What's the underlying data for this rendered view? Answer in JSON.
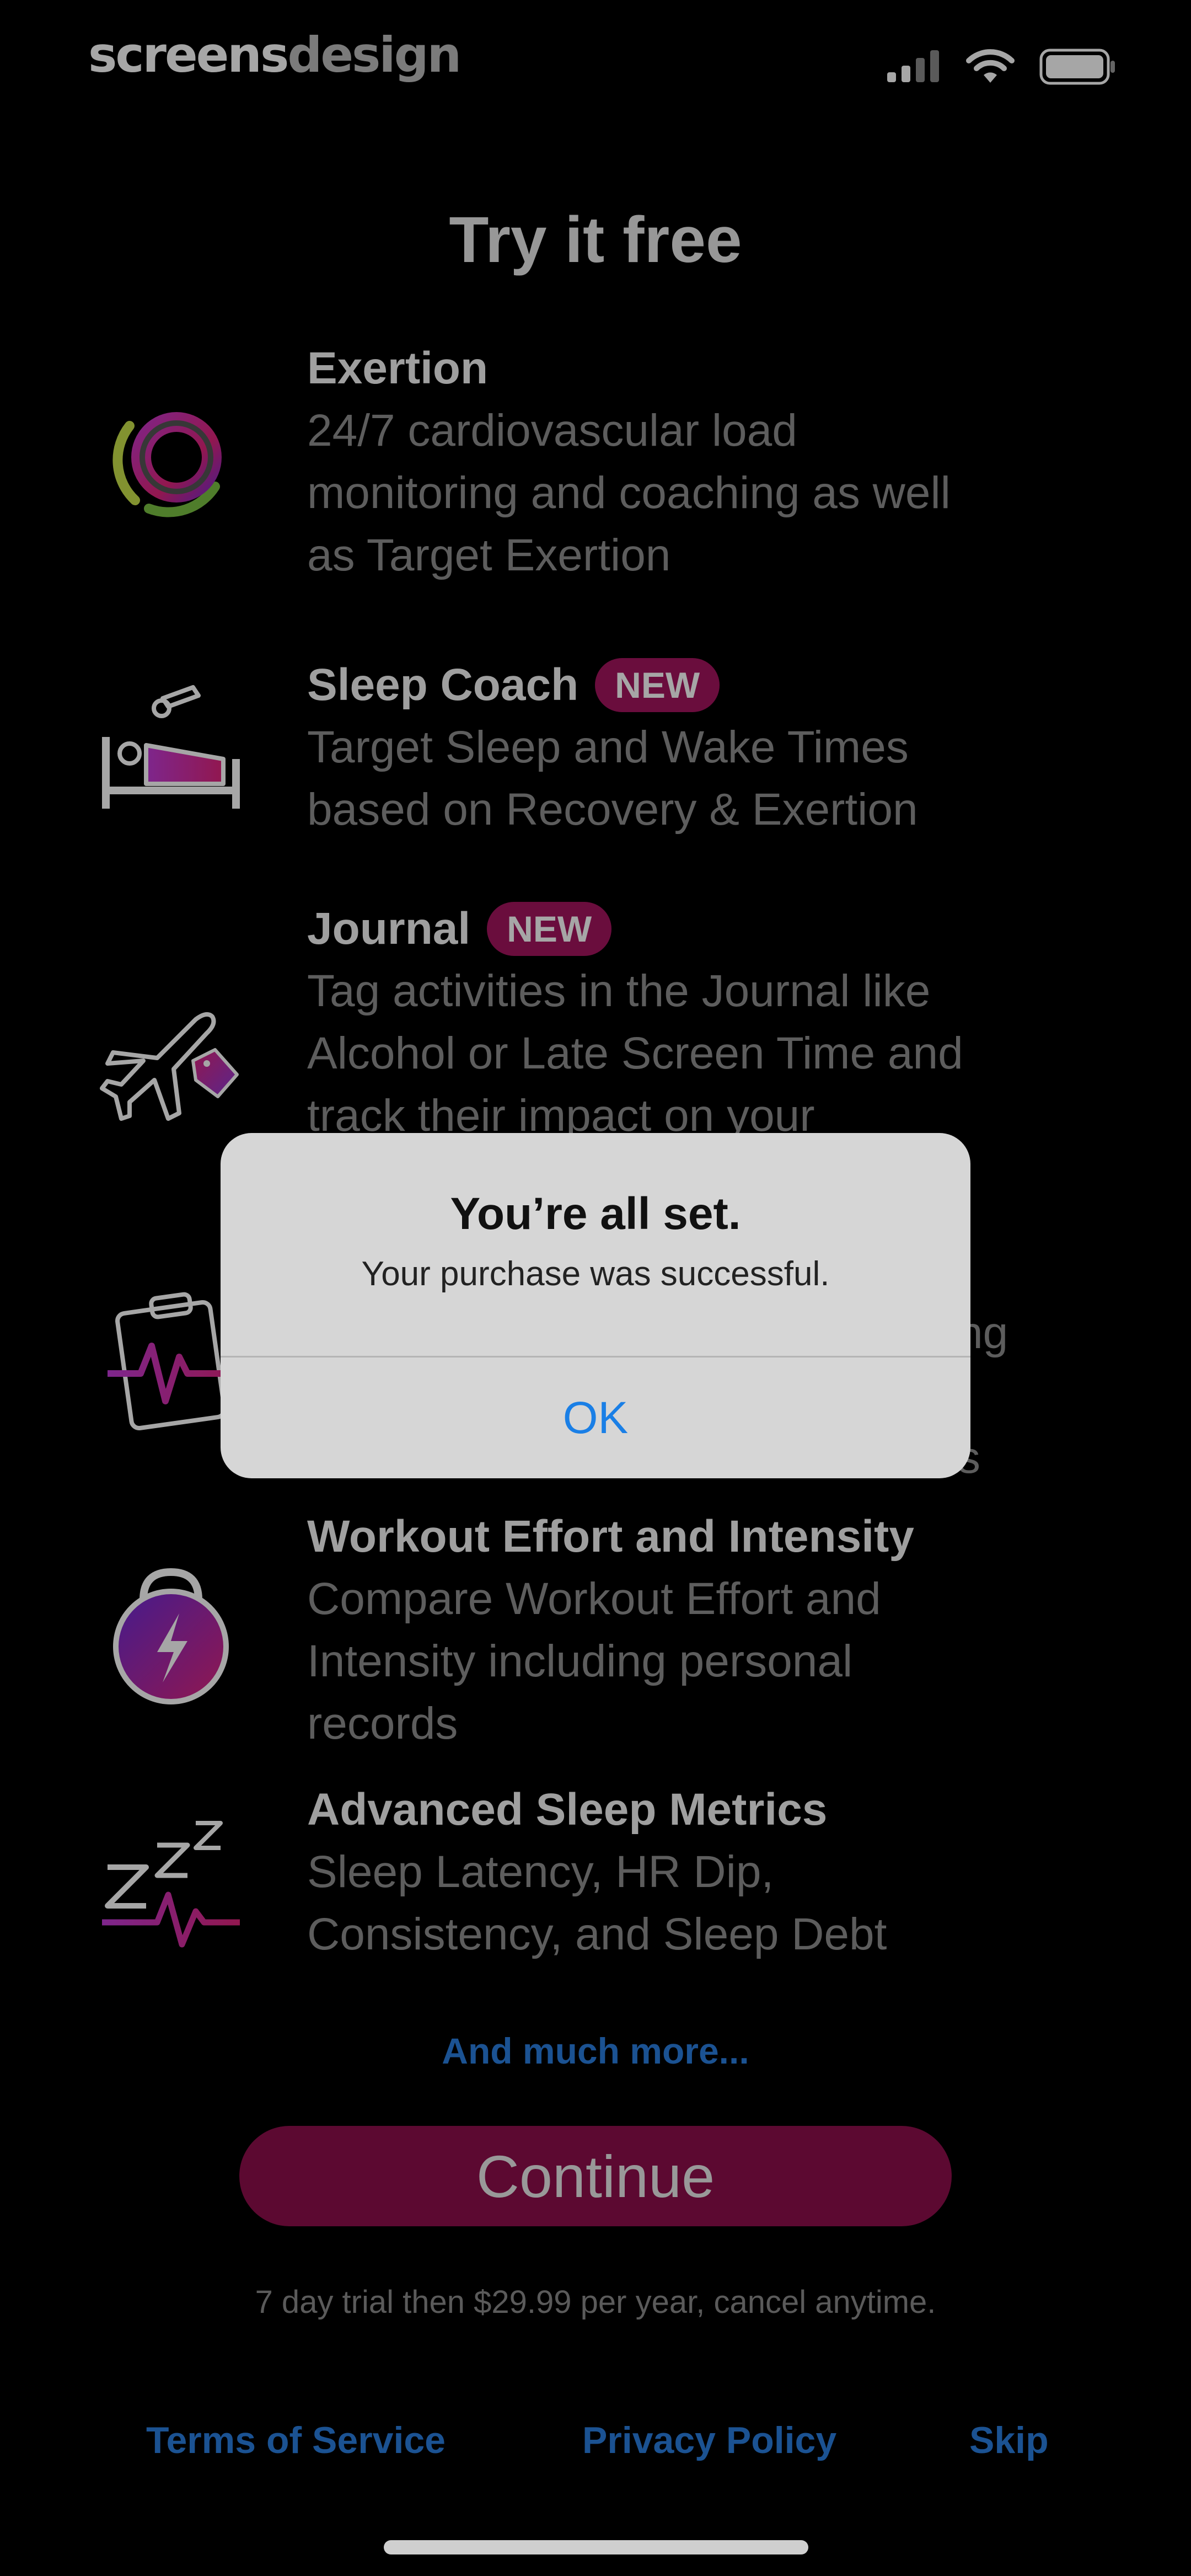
{
  "status_bar": {
    "brand_part1": "screens",
    "brand_part2": "design",
    "icons": [
      "signal-icon",
      "wifi-icon",
      "battery-icon"
    ]
  },
  "title": "Try it free",
  "features": [
    {
      "name": "Exertion",
      "badge": "",
      "desc_lines": [
        "24/7 cardiovascular load",
        "monitoring and coaching as well",
        "as Target Exertion"
      ],
      "icon": "exertion-ring-icon"
    },
    {
      "name": "Sleep Coach",
      "badge": "NEW",
      "desc_lines": [
        "Target Sleep and Wake Times",
        "based on Recovery & Exertion"
      ],
      "icon": "bed-whistle-icon"
    },
    {
      "name": "Journal",
      "badge": "NEW",
      "desc_lines": [
        "Tag activities in the Journal like",
        "Alcohol or Late Screen Time and",
        "track their impact on your"
      ],
      "icon": "airplane-tag-icon"
    },
    {
      "name": "Workout Effort and Intensity",
      "badge": "",
      "desc_lines": [
        "Compare Workout Effort and",
        "Intensity including personal",
        "records"
      ],
      "icon": "kettlebell-icon"
    },
    {
      "name": "Advanced Sleep Metrics",
      "badge": "",
      "desc_lines": [
        "Sleep Latency, HR Dip,",
        "Consistency, and Sleep Debt"
      ],
      "icon": "zzz-heartbeat-icon"
    }
  ],
  "obscured_fragments": {
    "line_end_1": "ng",
    "line_end_2": "s"
  },
  "alert": {
    "title": "You’re all set.",
    "message": "Your purchase was successful.",
    "ok_label": "OK"
  },
  "more_link": "And much more...",
  "continue_label": "Continue",
  "trial_note": "7 day trial then $29.99 per year, cancel anytime.",
  "footer": {
    "terms": "Terms of Service",
    "privacy": "Privacy Policy",
    "skip": "Skip"
  },
  "colors": {
    "accent_magenta": "#8e0e4c",
    "badge_magenta": "#a3145f",
    "link_blue": "#2a7ee0",
    "alert_bg": "#d6d6d6"
  }
}
